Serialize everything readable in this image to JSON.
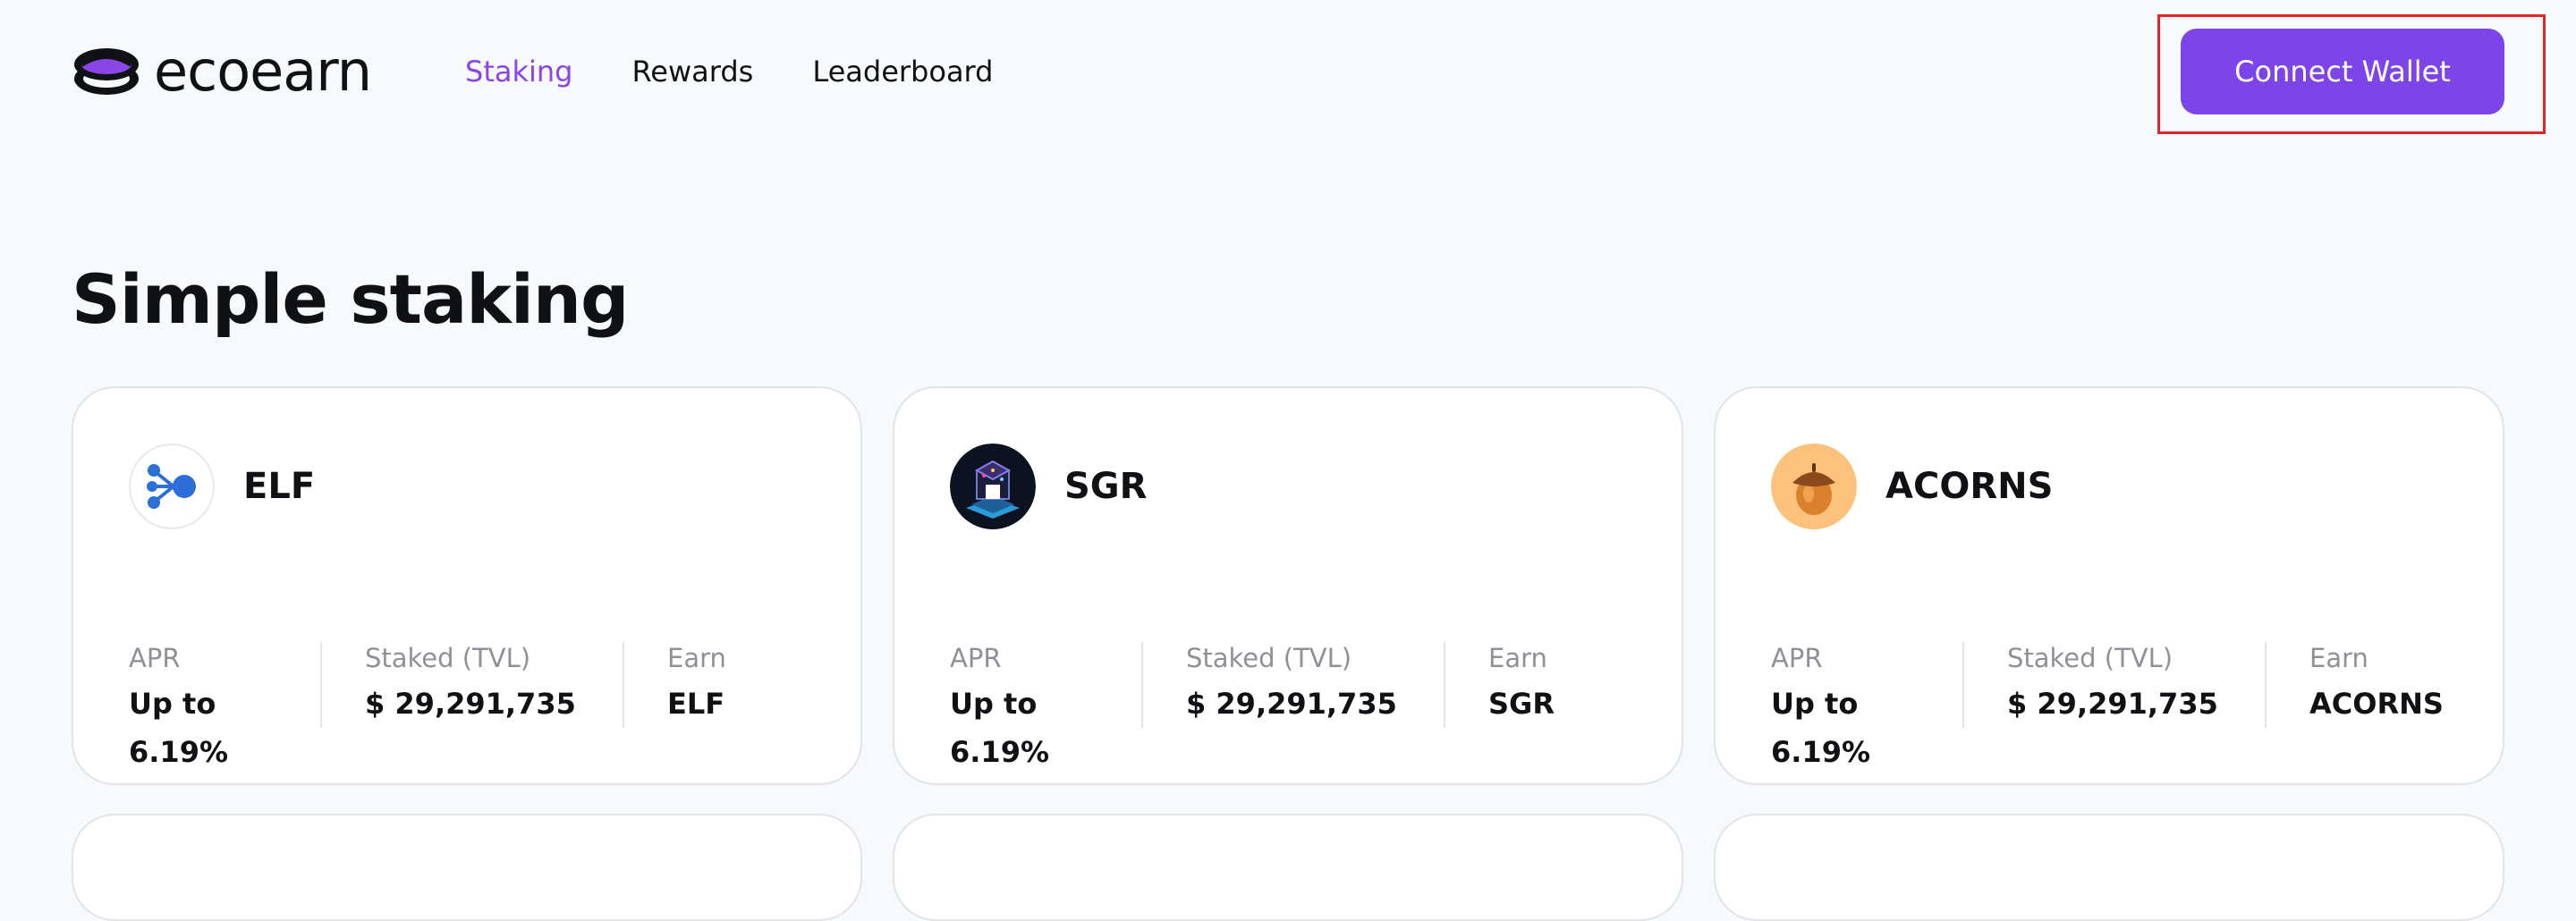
{
  "header": {
    "logo_text": "ecoearn",
    "nav": [
      {
        "label": "Staking",
        "active": true
      },
      {
        "label": "Rewards",
        "active": false
      },
      {
        "label": "Leaderboard",
        "active": false
      }
    ],
    "connect_wallet_label": "Connect Wallet"
  },
  "page_title": "Simple staking",
  "cards": [
    {
      "name": "ELF",
      "icon": "elf-token-icon",
      "apr_label": "APR",
      "apr_value": "Up to 6.19%",
      "tvl_label": "Staked (TVL)",
      "tvl_value": "$ 29,291,735",
      "earn_label": "Earn",
      "earn_value": "ELF"
    },
    {
      "name": "SGR",
      "icon": "sgr-token-icon",
      "apr_label": "APR",
      "apr_value": "Up to 6.19%",
      "tvl_label": "Staked (TVL)",
      "tvl_value": "$ 29,291,735",
      "earn_label": "Earn",
      "earn_value": "SGR"
    },
    {
      "name": "ACORNS",
      "icon": "acorn-token-icon",
      "apr_label": "APR",
      "apr_value": "Up to 6.19%",
      "tvl_label": "Staked (TVL)",
      "tvl_value": "$ 29,291,735",
      "earn_label": "Earn",
      "earn_value": "ACORNS"
    }
  ],
  "colors": {
    "accent": "#7d44e9",
    "nav_active": "#8a45e6",
    "highlight_box": "#e0262b",
    "background": "#f7fafd"
  }
}
